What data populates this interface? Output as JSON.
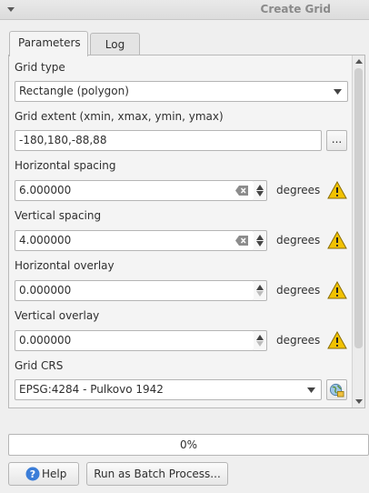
{
  "window": {
    "title": "Create Grid"
  },
  "tabs": [
    {
      "label": "Parameters",
      "active": true
    },
    {
      "label": "Log",
      "active": false
    }
  ],
  "params": {
    "grid_type": {
      "label": "Grid type",
      "value": "Rectangle (polygon)"
    },
    "grid_extent": {
      "label": "Grid extent (xmin, xmax, ymin, ymax)",
      "value": "-180,180,-88,88",
      "button": "..."
    },
    "h_spacing": {
      "label": "Horizontal spacing",
      "value": "6.000000",
      "unit": "degrees"
    },
    "v_spacing": {
      "label": "Vertical spacing",
      "value": "4.000000",
      "unit": "degrees"
    },
    "h_overlay": {
      "label": "Horizontal overlay",
      "value": "0.000000",
      "unit": "degrees"
    },
    "v_overlay": {
      "label": "Vertical overlay",
      "value": "0.000000",
      "unit": "degrees"
    },
    "grid_crs": {
      "label": "Grid CRS",
      "value": "EPSG:4284 - Pulkovo 1942"
    }
  },
  "progress": {
    "value": 0,
    "text": "0%"
  },
  "buttons": {
    "help": "Help",
    "batch": "Run as Batch Process..."
  },
  "colors": {
    "warning": "#f2c200",
    "help_icon": "#3b7dd8",
    "accent": "#3c8fde"
  },
  "icons": {
    "menu": "triangle-down-icon",
    "warning": "warning-icon",
    "clear": "clear-text-icon",
    "crs": "crs-globe-icon",
    "help": "help-icon"
  }
}
